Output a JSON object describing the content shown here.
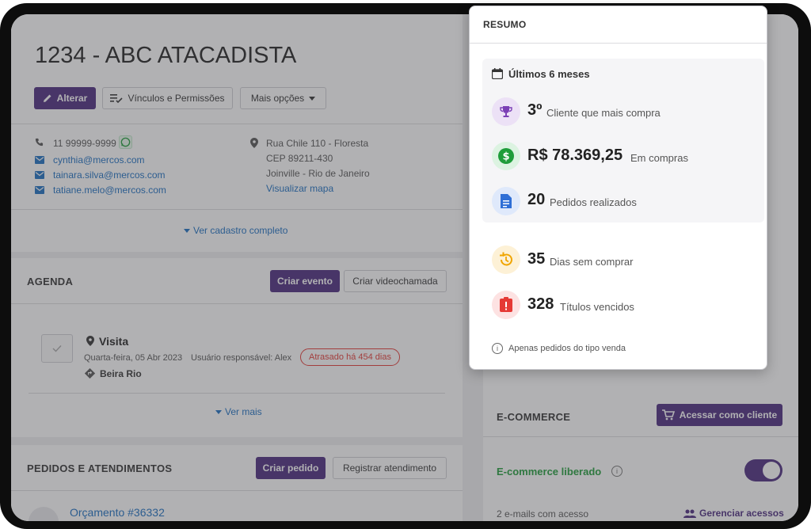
{
  "client": {
    "title": "1234 - ABC ATACADISTA",
    "btn_edit": "Alterar",
    "btn_links": "Vínculos e Permissões",
    "btn_more": "Mais opções",
    "phone": "11 99999-9999",
    "emails": [
      "cynthia@mercos.com",
      "tainara.silva@mercos.com",
      "tatiane.melo@mercos.com"
    ],
    "address_line1": "Rua Chile 110 - Floresta",
    "address_line2": "CEP 89211-430",
    "address_line3": "Joinville - Rio de Janeiro",
    "map_link": "Visualizar mapa",
    "full_record_link": "Ver cadastro completo"
  },
  "agenda": {
    "title": "AGENDA",
    "btn_create": "Criar evento",
    "btn_video": "Criar videochamada",
    "event_title": "Visita",
    "event_date": "Quarta-feira, 05 Abr 2023",
    "event_user": "Usuário responsável: Alex",
    "event_badge": "Atrasado há 454 dias",
    "event_place": "Beira Rio",
    "see_more": "Ver mais"
  },
  "orders": {
    "title": "PEDIDOS E ATENDIMENTOS",
    "btn_create": "Criar pedido",
    "btn_register": "Registrar atendimento",
    "first_item": "Orçamento #36332"
  },
  "ecommerce": {
    "title": "E-COMMERCE",
    "btn_access": "Acessar como cliente",
    "enabled_label": "E-commerce liberado",
    "enabled": true,
    "emails_access": "2 e-mails com acesso",
    "manage_access": "Gerenciar acessos"
  },
  "summary": {
    "title": "RESUMO",
    "period": "Últimos 6 meses",
    "rank_value": "3º",
    "rank_label": "Cliente que mais compra",
    "purchases_value": "R$ 78.369,25",
    "purchases_label": "Em compras",
    "orders_value": "20",
    "orders_label": "Pedidos realizados",
    "days_value": "35",
    "days_label": "Dias sem comprar",
    "overdue_value": "328",
    "overdue_label": "Títulos vencidos",
    "footnote": "Apenas pedidos do tipo venda"
  },
  "colors": {
    "primary": "#4a2a7e",
    "link": "#1b6ec2",
    "success": "#1f9d3a",
    "danger": "#e53935",
    "overlay": "#46464b"
  }
}
